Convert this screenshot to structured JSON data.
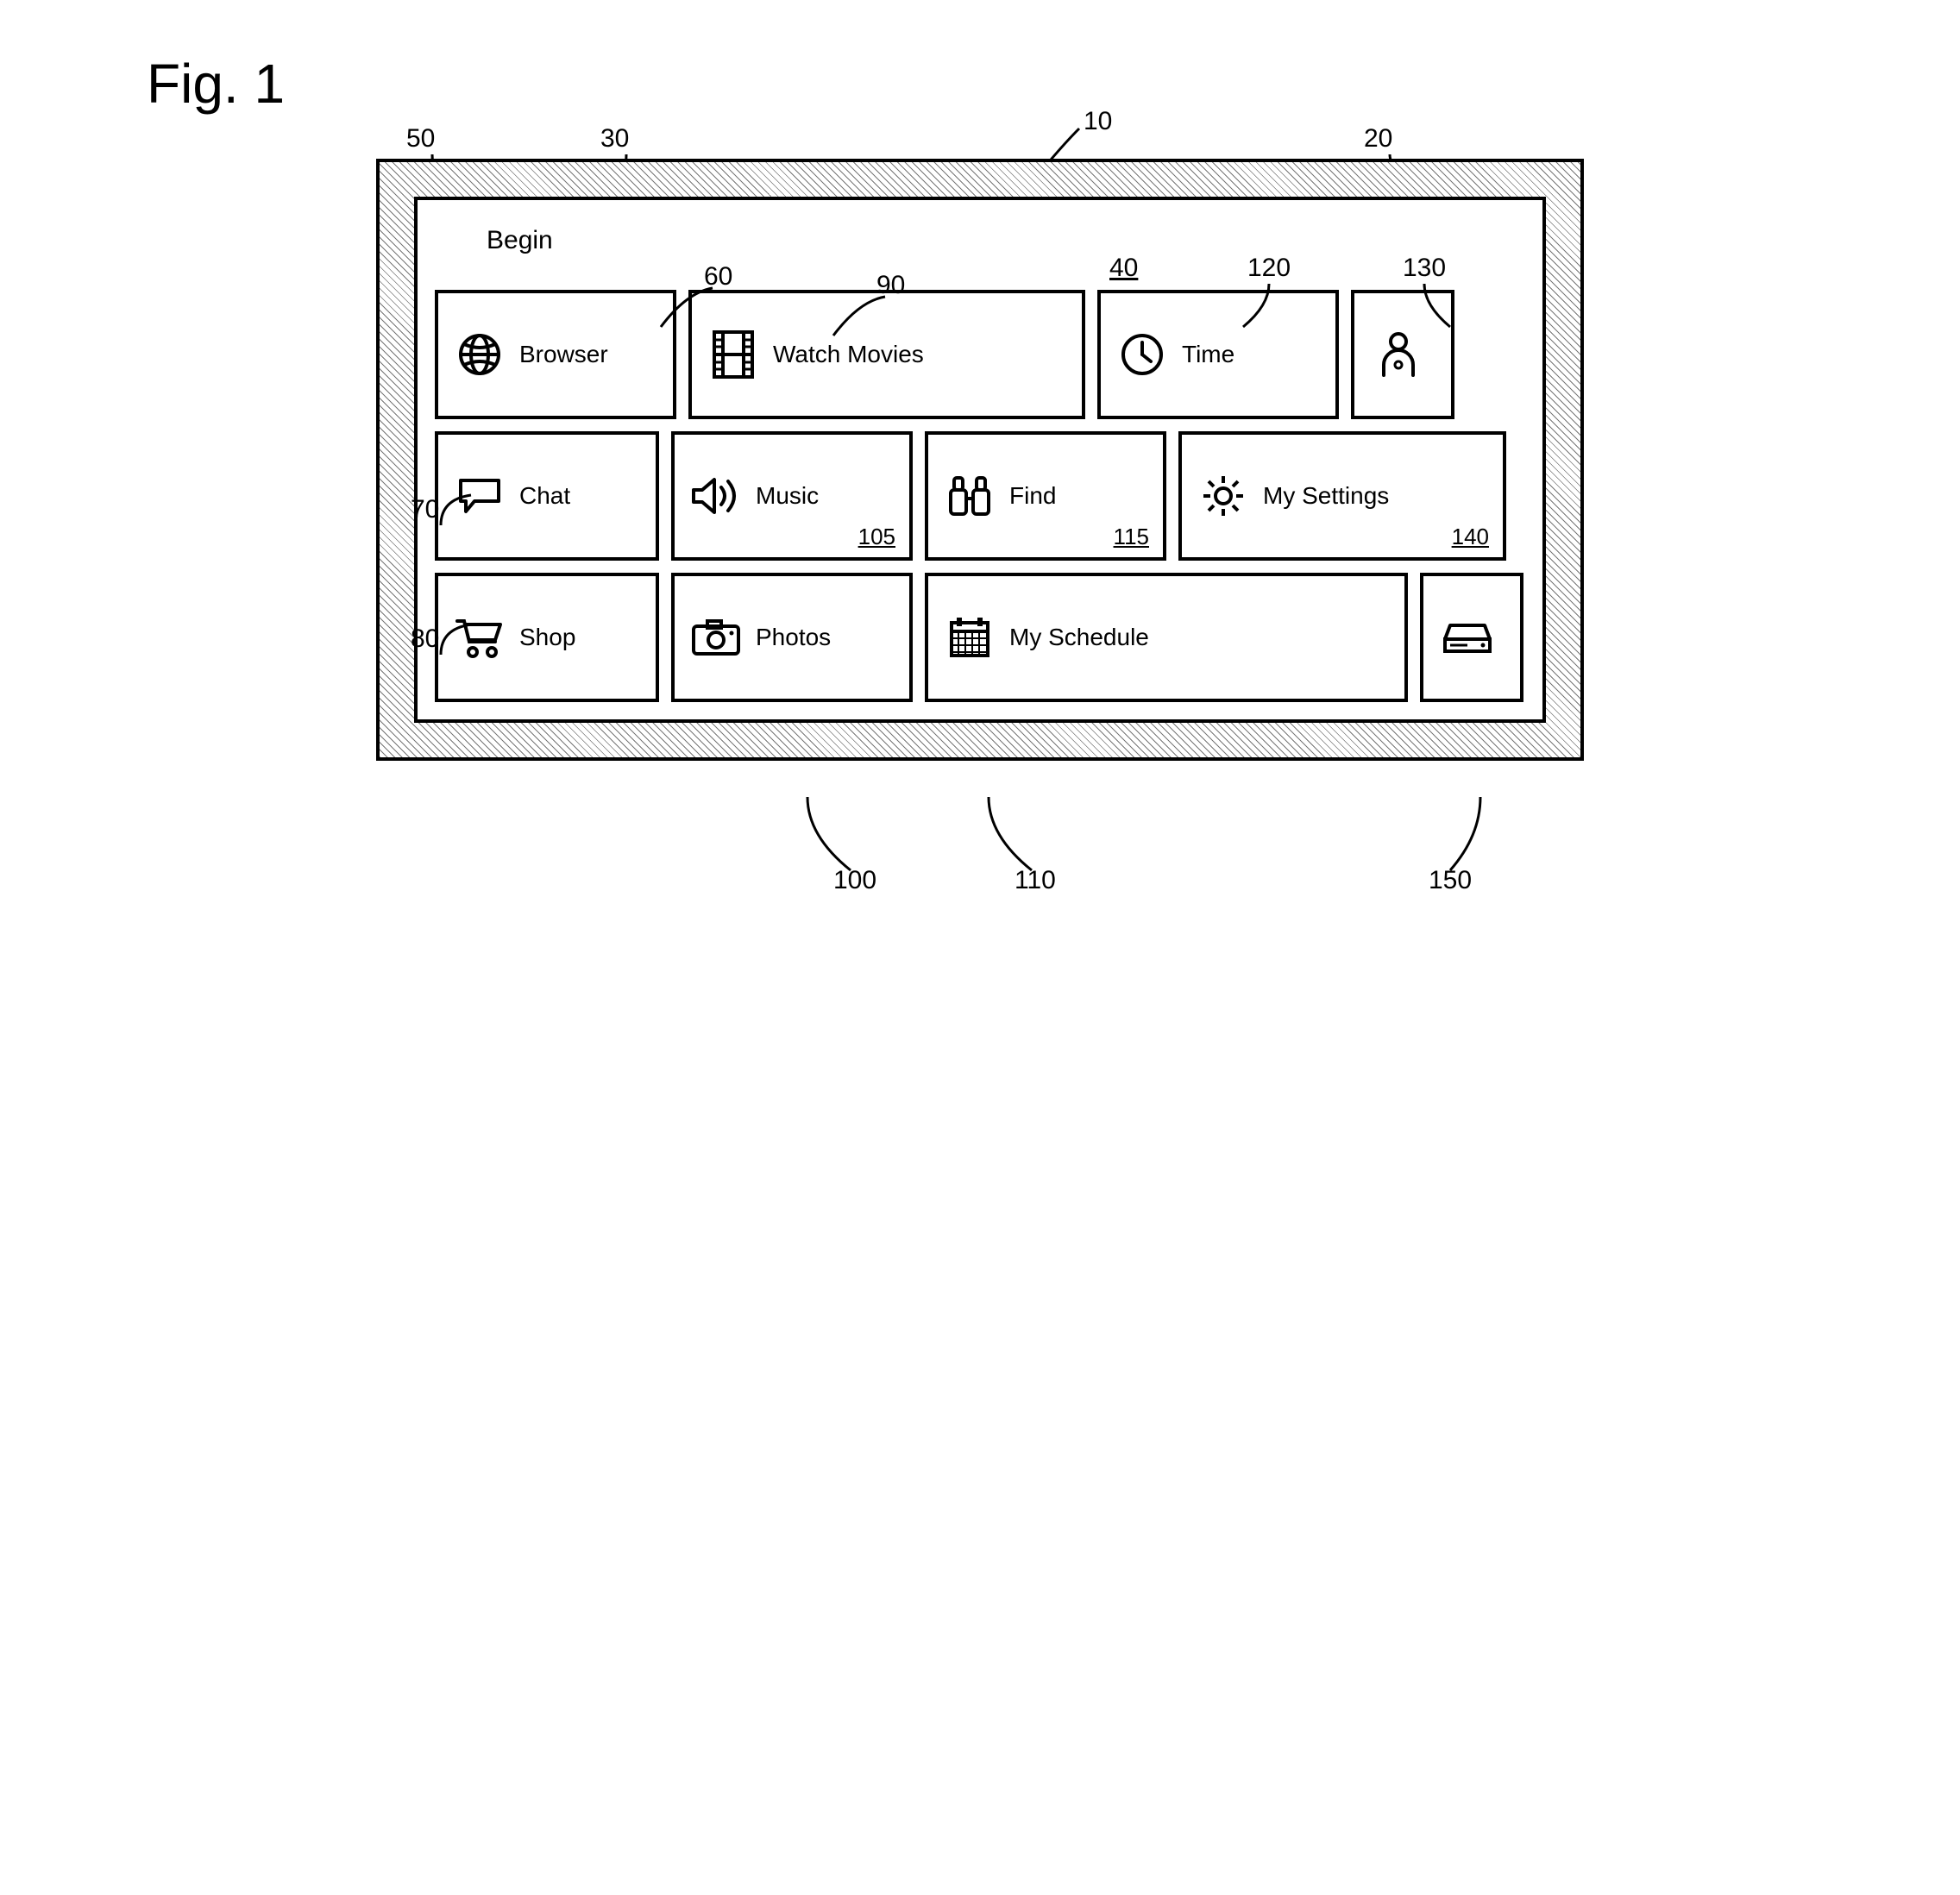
{
  "figure_title": "Fig. 1",
  "header": {
    "begin_label": "Begin"
  },
  "tiles": {
    "browser": {
      "label": "Browser"
    },
    "movies": {
      "label": "Watch Movies"
    },
    "time": {
      "label": "Time"
    },
    "chat": {
      "label": "Chat"
    },
    "music": {
      "label": "Music",
      "ref": "105"
    },
    "find": {
      "label": "Find",
      "ref": "115"
    },
    "settings": {
      "label": "My Settings",
      "ref": "140"
    },
    "shop": {
      "label": "Shop"
    },
    "photos": {
      "label": "Photos"
    },
    "schedule": {
      "label": "My Schedule"
    }
  },
  "callouts": {
    "c10": "10",
    "c20": "20",
    "c30": "30",
    "c40": "40",
    "c50": "50",
    "c60": "60",
    "c70": "70",
    "c80": "80",
    "c90": "90",
    "c100": "100",
    "c110": "110",
    "c120": "120",
    "c130": "130",
    "c150": "150"
  }
}
